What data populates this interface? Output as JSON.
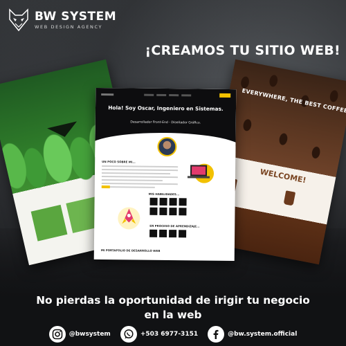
{
  "brand": {
    "title": "BW SYSTEM",
    "subtitle": "WEB DESIGN AGENCY"
  },
  "headline": "¡CREAMOS TU SITIO WEB!",
  "mockups": {
    "center": {
      "hello": "Hola! Soy Oscar, Ingeniero en Sistemas.",
      "role": "Desarrollador Front-End - Diseñador Gráfico.",
      "section_about": "UN POCO SOBRE MI...",
      "section_skills": "MIS HABILIDADES...",
      "section_learning": "EN PROCESO DE APRENDIZAJE...",
      "section_portfolio": "MI PORTAFOLIO DE DESARROLLO WEB"
    },
    "coffee": {
      "hero": "EVERYWHERE, THE BEST COFFEE AROUND",
      "welcome": "WELCOME!"
    }
  },
  "tagline": {
    "line1": "No pierdas la oportunidad de irigir tu negocio",
    "line2": "en la web"
  },
  "contacts": [
    {
      "icon": "instagram-icon",
      "label": "@bwsystem"
    },
    {
      "icon": "whatsapp-icon",
      "label": "+503 6977-3151"
    },
    {
      "icon": "facebook-icon",
      "label": "@bw.system.official"
    }
  ],
  "colors": {
    "background": "#1b1c1e",
    "accent_yellow": "#f2c100",
    "green": "#2f7d2a",
    "coffee": "#6b3a1d",
    "white": "#ffffff"
  }
}
